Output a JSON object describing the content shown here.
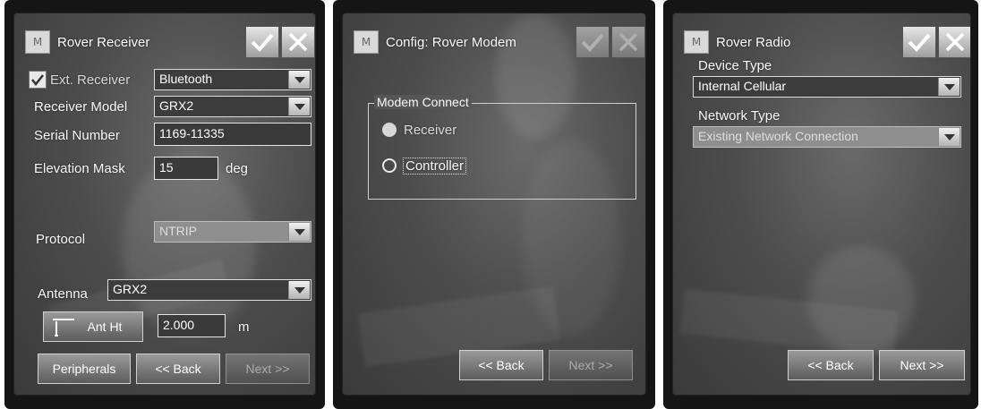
{
  "screen1": {
    "title": "Rover Receiver",
    "ext_receiver_label": "Ext. Receiver",
    "ext_receiver_checked": true,
    "ext_receiver_value": "Bluetooth",
    "receiver_model_label": "Receiver Model",
    "receiver_model_value": "GRX2",
    "serial_number_label": "Serial Number",
    "serial_number_value": "1169-11335",
    "elevation_mask_label": "Elevation Mask",
    "elevation_mask_value": "15",
    "elevation_mask_unit": "deg",
    "protocol_label": "Protocol",
    "protocol_value": "NTRIP",
    "antenna_label": "Antenna",
    "antenna_value": "GRX2",
    "ant_ht_button": "Ant Ht",
    "ant_ht_value": "2.000",
    "ant_ht_unit": "m",
    "peripherals_button": "Peripherals",
    "back_button": "<< Back",
    "next_button": "Next >>"
  },
  "screen2": {
    "title": "Config: Rover Modem",
    "group_label": "Modem Connect",
    "option_receiver": "Receiver",
    "option_controller": "Controller",
    "back_button": "<< Back",
    "next_button": "Next >>"
  },
  "screen3": {
    "title": "Rover Radio",
    "device_type_label": "Device Type",
    "device_type_value": "Internal Cellular",
    "network_type_label": "Network Type",
    "network_type_value": "Existing Network Connection",
    "back_button": "<< Back",
    "next_button": "Next >>"
  },
  "icons": {
    "app": "app-logo-icon",
    "ok": "checkmark-icon",
    "cancel": "close-icon",
    "dropdown": "chevron-down-icon",
    "antenna": "antenna-height-icon"
  }
}
